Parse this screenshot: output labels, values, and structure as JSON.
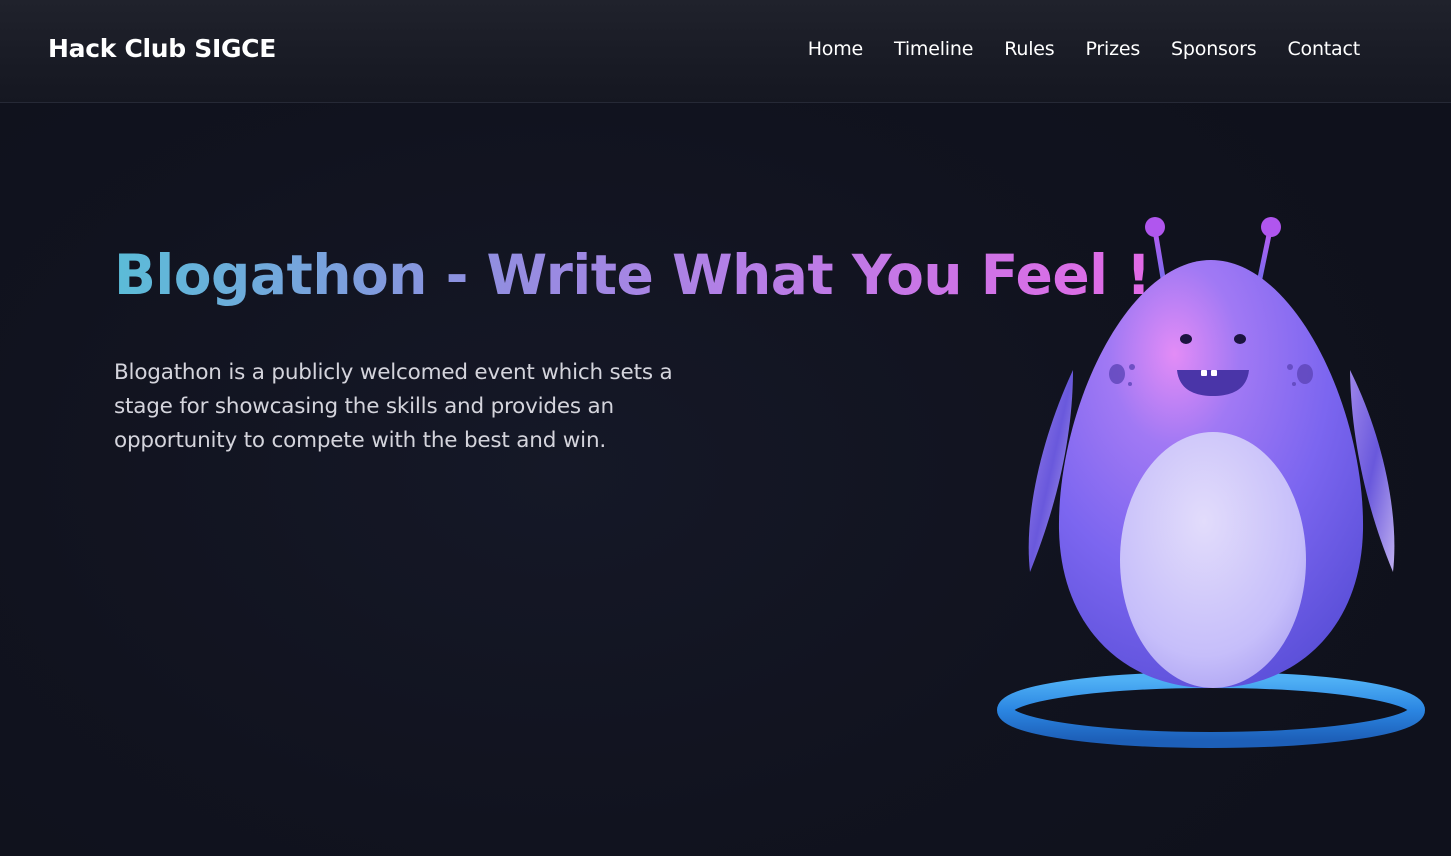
{
  "header": {
    "brand": "Hack Club SIGCE",
    "nav": [
      {
        "label": "Home"
      },
      {
        "label": "Timeline"
      },
      {
        "label": "Rules"
      },
      {
        "label": "Prizes"
      },
      {
        "label": "Sponsors"
      },
      {
        "label": "Contact"
      }
    ]
  },
  "hero": {
    "title": "Blogathon - Write What You Feel !",
    "description": "Blogathon is a publicly welcomed event which sets a stage for showcasing the skills and provides an opportunity to compete with the best and win.",
    "illustration_icon": "purple-egg-robot-mascot"
  },
  "colors": {
    "background": "#11131f",
    "gradient_start": "#5bbcd8",
    "gradient_end": "#e26ae6",
    "ring": "#2f8ee8",
    "mascot_body": "#8a6cf2"
  }
}
